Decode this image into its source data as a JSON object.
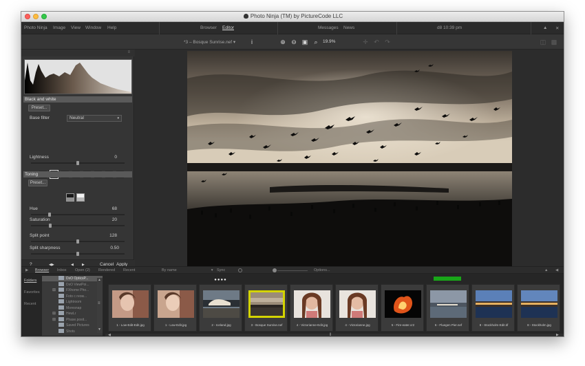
{
  "window": {
    "title": "Photo Ninja (TM) by PictureCode LLC"
  },
  "menu": {
    "items": [
      "Photo Ninja",
      "Image",
      "View",
      "Window",
      "Help"
    ],
    "tabs": [
      "Browser",
      "Editor"
    ],
    "active_tab": "Editor",
    "right_items": [
      "Messages",
      "News"
    ],
    "clock": "d8 10:39 pm",
    "up_arrow": "▲",
    "close": "✕"
  },
  "toolbar": {
    "filename": "*3 – Bosque Sunrise.nef",
    "zoom": "19.9%",
    "info_glyph": "i",
    "dropdown_glyph": "▾",
    "zoom_in": "⊕",
    "zoom_out": "⊖",
    "fit": "▣",
    "zoom_tool": "⌕",
    "crosshair": "✛",
    "undo": "↶",
    "redo": "↷",
    "layout1": "◫",
    "layout2": "▩"
  },
  "left_panel": {
    "top_glyph": "≡",
    "section_bw": "Black and white",
    "preset_label": "Preset...",
    "base_filter_label": "Base filter",
    "base_filter_value": "Neutral",
    "select_arrow": "▾",
    "swatches": [
      "#d05650",
      "#c8602e",
      "#a07a2e",
      "#6a9a30",
      "#2f9a6a",
      "#2f8fb8",
      "#3a66c8",
      "#9060c0"
    ],
    "selected_swatch": 1,
    "lightness_label": "Lightness",
    "lightness_value": "0",
    "lightness_level": 0.5,
    "section_toning": "Toning",
    "preset2_label": "Preset...",
    "hue_label": "Hue",
    "hue_value": "68",
    "hue_level": 0.19,
    "saturation_label": "Saturation",
    "saturation_value": "20",
    "saturation_level": 0.2,
    "split_point_label": "Split point",
    "split_point_value": "128",
    "split_point_level": 0.5,
    "split_sharpness_label": "Split sharpness",
    "split_sharpness_value": "0.50",
    "split_sharpness_level": 0.5,
    "help_glyph": "?",
    "compare_glyph": "◀▶",
    "prev_glyph": "◀",
    "next_glyph": "▶",
    "cancel_label": "Cancel",
    "apply_label": "Apply"
  },
  "browser": {
    "collapse_glyph": "▶",
    "tabs": [
      "Browser",
      "Inbox",
      "Open (2)",
      "Rendered",
      "Recent"
    ],
    "sort": "By name",
    "sort_arrow": "▾",
    "sync": "Sync",
    "options": "Options...",
    "right_glyph": "◀",
    "expand_glyph": "▲",
    "side_labels": [
      "Folders",
      "Favorites",
      "Recent"
    ],
    "tree": [
      "DxO OpticsP...",
      "DxO ViewPoi...",
      "FXhome Pho...",
      "Foto с геом...",
      "Lightroom",
      "Moresnap",
      "HewLr",
      "Phase.posit...",
      "Saved Pictures",
      "Shots"
    ],
    "tree_plus": "⊞",
    "scroll_up": "▲",
    "scroll_down": "▼",
    "scroll_grip": "≡",
    "thumbnails": [
      {
        "caption": "1 - Low-Edit-Edit.jpg"
      },
      {
        "caption": "1 - Low-Edit.jpg"
      },
      {
        "caption": "2 - Iceland.jpg"
      },
      {
        "caption": "3 - Bosque Sunrise.nef"
      },
      {
        "caption": "4 - Victorianne-Edit.jpg"
      },
      {
        "caption": "4 - Victorianne.jpg"
      },
      {
        "caption": "5 - Fire-eater.cr2"
      },
      {
        "caption": "6 - Fluegen Pier.nef"
      },
      {
        "caption": "8 - Stockholm-Edit.tif"
      },
      {
        "caption": "8 - Stockholm.jpg"
      }
    ],
    "dots": "●●●●",
    "hscroll_left": "◀",
    "hscroll_mid": "‖",
    "hscroll_right": "▶"
  }
}
